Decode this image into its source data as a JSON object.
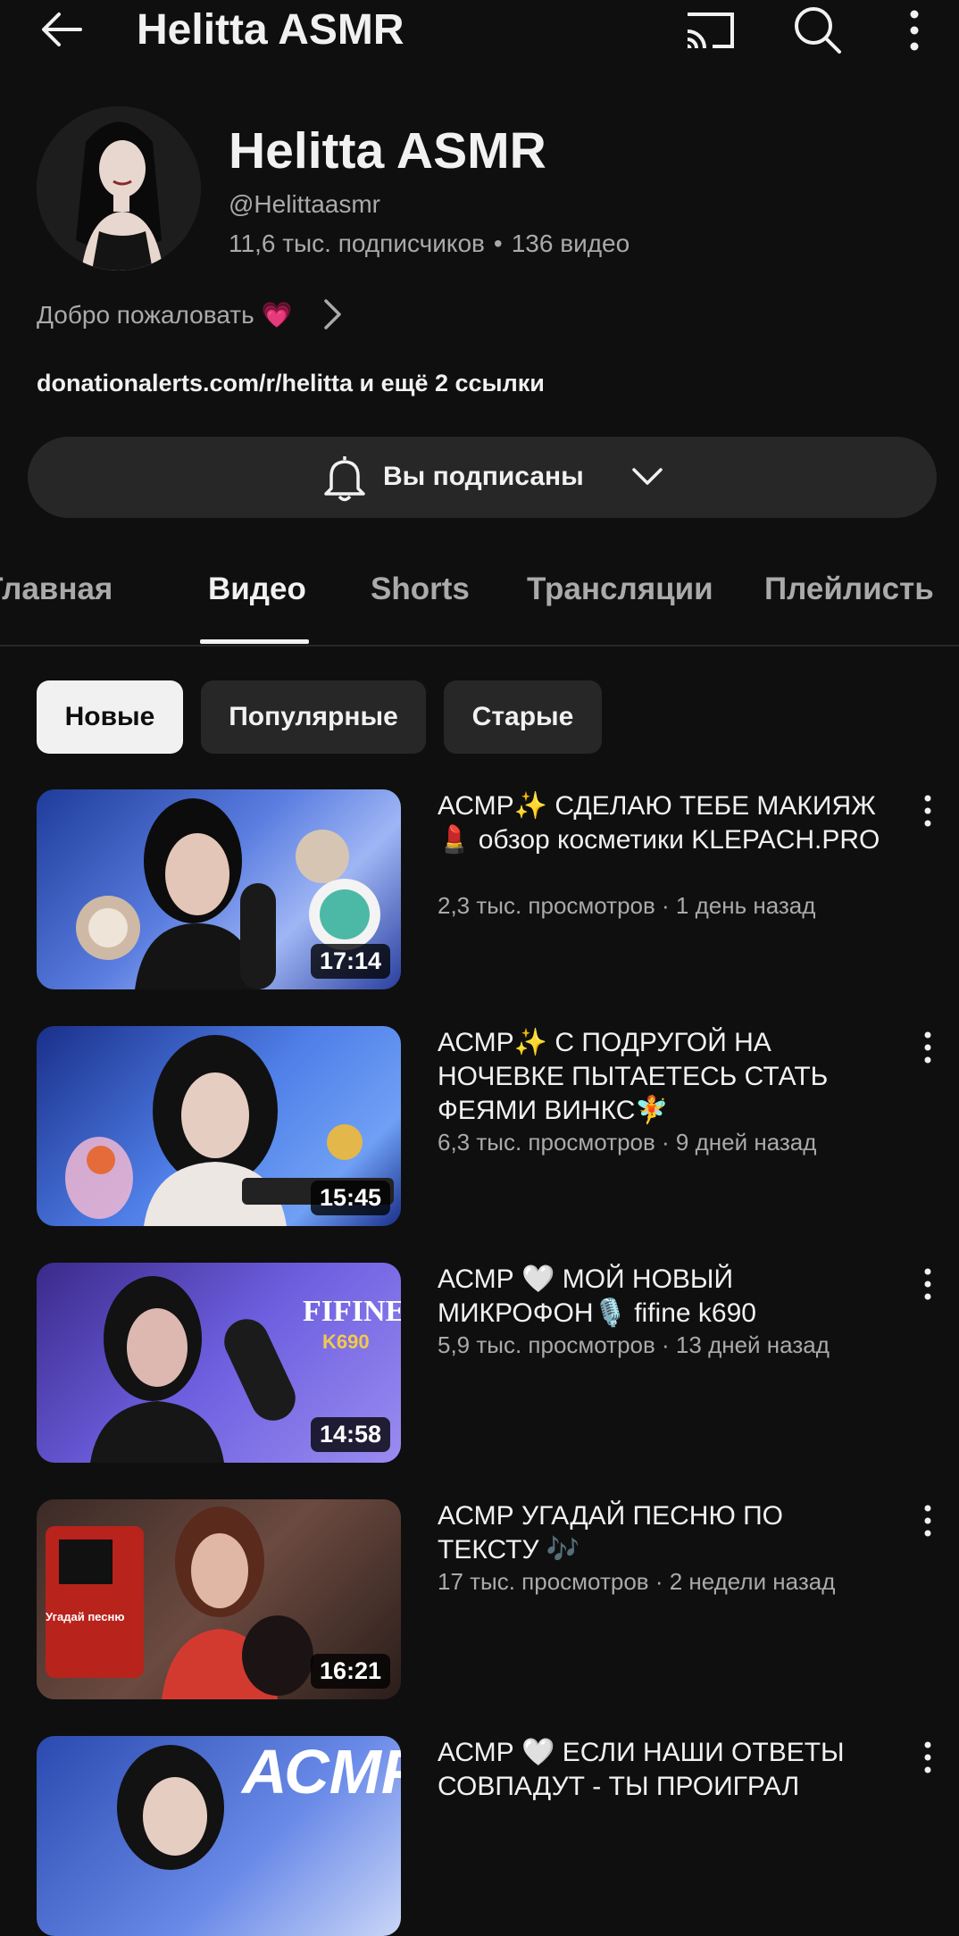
{
  "top_bar": {
    "title": "Helitta ASMR"
  },
  "channel": {
    "name": "Helitta ASMR",
    "handle": "@Helittaasmr",
    "subscribers": "11,6 тыс. подписчиков",
    "videos_count": "136 видео",
    "separator": "•",
    "welcome": "Добро пожаловать 💗",
    "links": "donationalerts.com/r/helitta и ещё 2 ссылки",
    "subscribe_label": "Вы подписаны"
  },
  "tabs": [
    {
      "label": "Главная"
    },
    {
      "label": "Видео"
    },
    {
      "label": "Shorts"
    },
    {
      "label": "Трансляции"
    },
    {
      "label": "Плейлисть"
    }
  ],
  "chips": [
    {
      "label": "Новые"
    },
    {
      "label": "Популярные"
    },
    {
      "label": "Старые"
    }
  ],
  "videos": [
    {
      "title": "АСМР✨ СДЕЛАЮ ТЕБЕ МАКИЯЖ💄 обзор косметики KLEPACH.PRO",
      "meta": "2,3 тыс. просмотров · 1 день назад",
      "duration": "17:14"
    },
    {
      "title": "АСМР✨ С ПОДРУГОЙ НА НОЧЕВКЕ ПЫТАЕТЕСЬ СТАТЬ ФЕЯМИ ВИНКС🧚",
      "meta": "6,3 тыс. просмотров · 9 дней назад",
      "duration": "15:45"
    },
    {
      "title": "АСМР 🤍 МОЙ НОВЫЙ МИКРОФОН🎙️ fifine k690",
      "meta": "5,9 тыс. просмотров · 13 дней назад",
      "duration": "14:58",
      "thumb_text": "FIFINE",
      "thumb_subtext": "K690"
    },
    {
      "title": "АСМР УГАДАЙ ПЕСНЮ ПО ТЕКСТУ 🎶",
      "meta": "17 тыс. просмотров · 2 недели назад",
      "duration": "16:21",
      "thumb_text": "Угадай песню"
    },
    {
      "title": "АСМР 🤍 ЕСЛИ НАШИ ОТВЕТЫ СОВПАДУТ - ТЫ ПРОИГРАЛ",
      "meta": "",
      "thumb_text": "АСМР"
    }
  ]
}
